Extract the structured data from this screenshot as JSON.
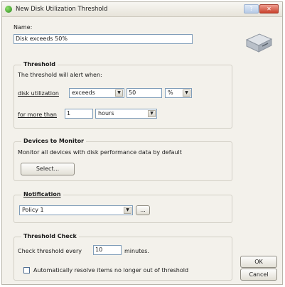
{
  "window": {
    "title": "New Disk Utilization Threshold"
  },
  "name": {
    "label": "Name:",
    "value": "Disk exceeds 50%"
  },
  "threshold": {
    "legend": "Threshold",
    "intro": "The threshold will alert when:",
    "metric_label": "disk utilization",
    "operator": "exceeds",
    "value": "50",
    "unit": "%",
    "duration_label": "for more than",
    "duration_value": "1",
    "duration_unit": "hours"
  },
  "devices": {
    "legend": "Devices to Monitor",
    "description": "Monitor all devices with disk performance data by default",
    "select_button": "Select..."
  },
  "notification": {
    "legend": "Notification",
    "policy": "Policy 1",
    "browse_button": "..."
  },
  "threshold_check": {
    "legend": "Threshold Check",
    "prefix": "Check threshold every",
    "value": "10",
    "suffix": "minutes.",
    "auto_resolve_label": "Automatically resolve items no longer out of threshold",
    "auto_resolve_checked": false
  },
  "actions": {
    "ok": "OK",
    "cancel": "Cancel"
  },
  "icons": {
    "app": "green-globe-icon",
    "disk": "hard-disk-icon",
    "dropdown": "chevron-down-icon"
  },
  "colors": {
    "field_border": "#7f9db9",
    "window_bg": "#f3f1eb",
    "close_button": "#c9432e"
  }
}
